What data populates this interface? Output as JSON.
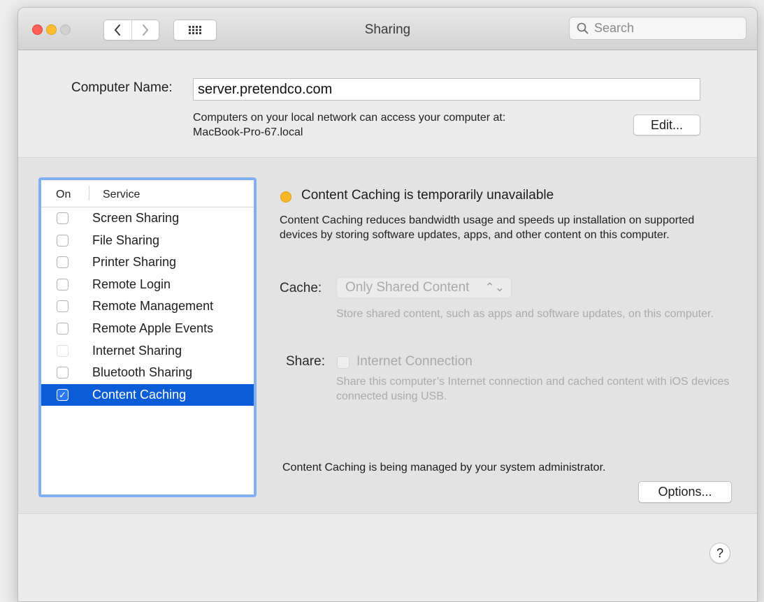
{
  "window": {
    "title": "Sharing",
    "search_placeholder": "Search"
  },
  "computer_name": {
    "label": "Computer Name:",
    "value": "server.pretendco.com",
    "note_line1": "Computers on your local network can access your computer at:",
    "note_line2": "MacBook-Pro-67.local",
    "edit_label": "Edit..."
  },
  "services": {
    "col_on": "On",
    "col_service": "Service",
    "items": [
      {
        "label": "Screen Sharing",
        "checked": false
      },
      {
        "label": "File Sharing",
        "checked": false
      },
      {
        "label": "Printer Sharing",
        "checked": false
      },
      {
        "label": "Remote Login",
        "checked": false
      },
      {
        "label": "Remote Management",
        "checked": false
      },
      {
        "label": "Remote Apple Events",
        "checked": false
      },
      {
        "label": "Internet Sharing",
        "checked": false
      },
      {
        "label": "Bluetooth Sharing",
        "checked": false
      },
      {
        "label": "Content Caching",
        "checked": true
      }
    ],
    "check_mark": "✓"
  },
  "detail": {
    "status_text": "Content Caching is temporarily unavailable",
    "status_color": "#f7b728",
    "description": "Content Caching reduces bandwidth usage and speeds up installation on supported devices by storing software updates, apps, and other content on this computer.",
    "cache_label": "Cache:",
    "cache_value": "Only Shared Content",
    "cache_note": "Store shared content, such as apps and software updates, on this computer.",
    "share_label": "Share:",
    "share_option": "Internet Connection",
    "share_note": "Share this computer’s Internet connection and cached content with iOS devices connected using USB.",
    "managed_text": "Content Caching is being managed by your system administrator.",
    "options_label": "Options..."
  },
  "help_label": "?",
  "colors": {
    "selection": "#0b5cd7",
    "focus_ring": "#82aef6"
  }
}
